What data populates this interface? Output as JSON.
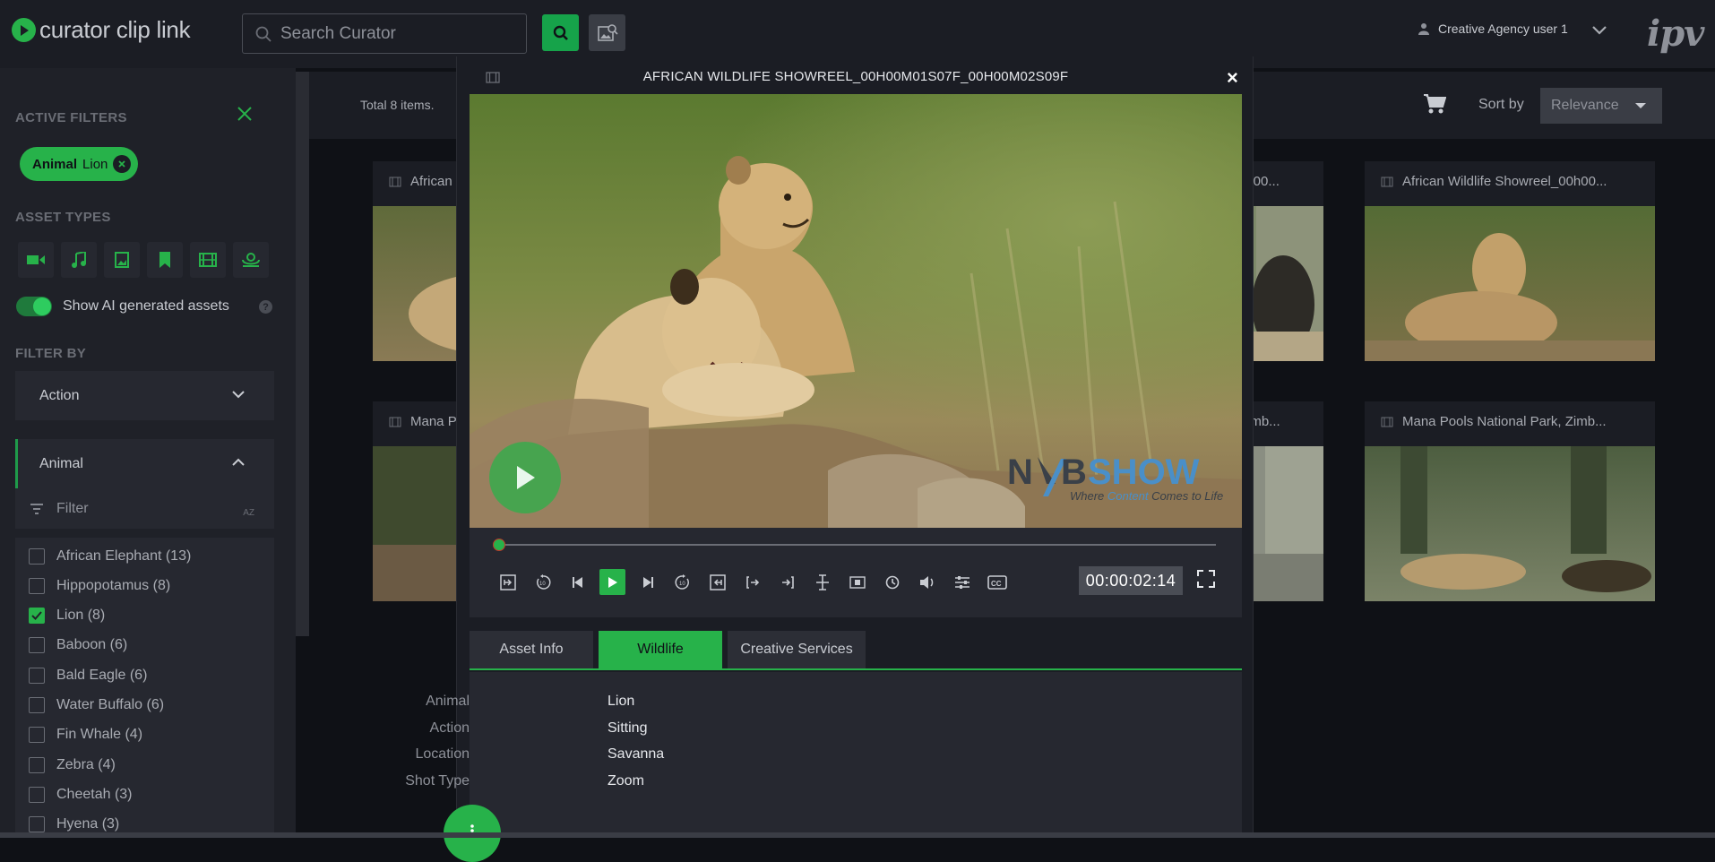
{
  "app": {
    "logo_text": "curator clip link",
    "brand": "ipv",
    "accent": "#27b24a"
  },
  "search": {
    "placeholder": "Search Curator",
    "value": ""
  },
  "user": {
    "name": "Creative Agency user 1"
  },
  "sidebar": {
    "active_filters_title": "ACTIVE FILTERS",
    "active_chip": {
      "key": "Animal",
      "value": "Lion"
    },
    "asset_types_title": "ASSET TYPES",
    "asset_type_icons": [
      "video-icon",
      "music-icon",
      "image-icon",
      "bookmark-icon",
      "film-strip-icon",
      "collection-icon"
    ],
    "ai_toggle_label": "Show AI generated assets",
    "ai_toggle_on": true,
    "filter_by_title": "FILTER BY",
    "facets": [
      {
        "label": "Action",
        "expanded": false
      },
      {
        "label": "Animal",
        "expanded": true
      }
    ],
    "filter_placeholder": "Filter",
    "animal_options": [
      {
        "label": "African Elephant (13)",
        "checked": false
      },
      {
        "label": "Hippopotamus (8)",
        "checked": false
      },
      {
        "label": "Lion (8)",
        "checked": true
      },
      {
        "label": "Baboon (6)",
        "checked": false
      },
      {
        "label": "Bald Eagle (6)",
        "checked": false
      },
      {
        "label": "Water Buffalo (6)",
        "checked": false
      },
      {
        "label": "Fin Whale (4)",
        "checked": false
      },
      {
        "label": "Zebra (4)",
        "checked": false
      },
      {
        "label": "Cheetah (3)",
        "checked": false
      },
      {
        "label": "Hyena (3)",
        "checked": false
      }
    ]
  },
  "results": {
    "total": "Total 8 items.",
    "sort_label": "Sort by",
    "sort_value": "Relevance",
    "cards": [
      {
        "title": "African",
        "row": 0
      },
      {
        "title": "0h00...",
        "row": 0
      },
      {
        "title": "African Wildlife Showreel_00h00...",
        "row": 0
      },
      {
        "title": "Mana P",
        "row": 1
      },
      {
        "title": "imb...",
        "row": 1
      },
      {
        "title": "Mana Pools National Park, Zimb...",
        "row": 1
      }
    ]
  },
  "player": {
    "title": "AFRICAN WILDLIFE SHOWREEL_00H00M01S07F_00H00M02S09F",
    "timecode": "00:00:02:14",
    "progress": 0.006,
    "watermark": {
      "brand": "NABSHOW",
      "tagline": "Where Content Comes to Life"
    },
    "tools": [
      "mark-in-frame-icon",
      "rewind-10-icon",
      "step-back-icon",
      "play-icon",
      "step-forward-icon",
      "forward-10-icon",
      "mark-out-frame-icon",
      "set-in-icon",
      "set-out-icon",
      "split-icon",
      "subclip-icon",
      "clock-icon",
      "volume-icon",
      "settings-icon",
      "closed-captions-icon"
    ],
    "tabs": [
      {
        "label": "Asset Info",
        "active": false
      },
      {
        "label": "Wildlife",
        "active": true
      },
      {
        "label": "Creative Services",
        "active": false
      }
    ],
    "metadata": [
      {
        "key": "Animal",
        "value": "Lion"
      },
      {
        "key": "Action",
        "value": "Sitting"
      },
      {
        "key": "Location",
        "value": "Savanna"
      },
      {
        "key": "Shot Type",
        "value": "Zoom"
      }
    ]
  }
}
